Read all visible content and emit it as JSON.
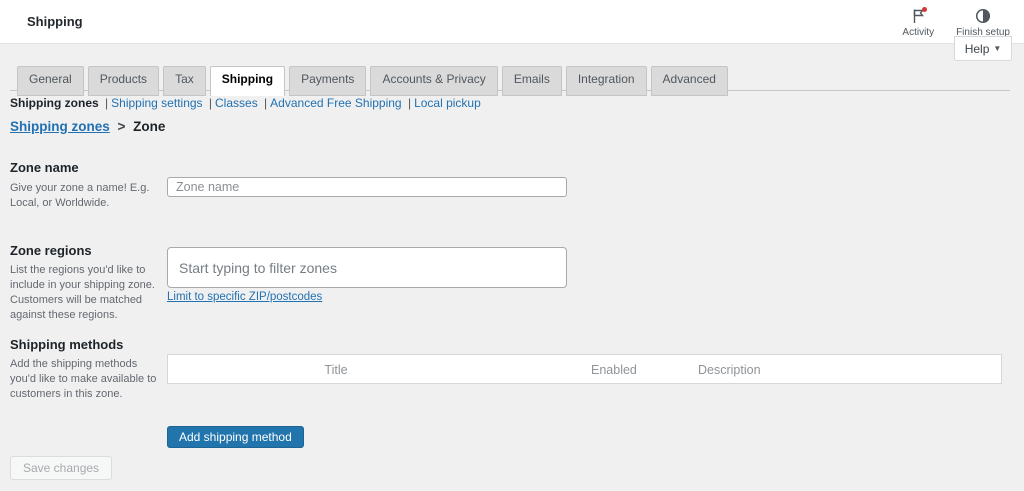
{
  "header": {
    "title": "Shipping",
    "activity_label": "Activity",
    "finish_setup_label": "Finish setup",
    "help_label": "Help"
  },
  "tabs": [
    {
      "label": "General"
    },
    {
      "label": "Products"
    },
    {
      "label": "Tax"
    },
    {
      "label": "Shipping",
      "active": true
    },
    {
      "label": "Payments"
    },
    {
      "label": "Accounts & Privacy"
    },
    {
      "label": "Emails"
    },
    {
      "label": "Integration"
    },
    {
      "label": "Advanced"
    }
  ],
  "subnav": {
    "current": "Shipping zones",
    "separator": "|",
    "links": [
      {
        "label": "Shipping settings"
      },
      {
        "label": "Classes"
      },
      {
        "label": "Advanced Free Shipping"
      },
      {
        "label": "Local pickup"
      }
    ]
  },
  "breadcrumb": {
    "link": "Shipping zones",
    "separator": ">",
    "current": "Zone"
  },
  "sections": {
    "zone_name": {
      "heading": "Zone name",
      "description": "Give your zone a name! E.g. Local, or Worldwide.",
      "input_value": "",
      "input_placeholder": "Zone name"
    },
    "zone_regions": {
      "heading": "Zone regions",
      "description": "List the regions you'd like to include in your shipping zone. Customers will be matched against these regions.",
      "input_value": "",
      "input_placeholder": "Start typing to filter zones",
      "zip_link": "Limit to specific ZIP/postcodes"
    },
    "shipping_methods": {
      "heading": "Shipping methods",
      "description": "Add the shipping methods you'd like to make available to customers in this zone.",
      "table_headers": [
        "Title",
        "Enabled",
        "Description"
      ],
      "rows": [],
      "add_button": "Add shipping method"
    }
  },
  "footer": {
    "save_button": "Save changes"
  },
  "colors": {
    "link_blue": "#2271b1",
    "button_blue": "#2274ad",
    "notification_red": "#d63638",
    "page_background": "#f0f0f1"
  }
}
